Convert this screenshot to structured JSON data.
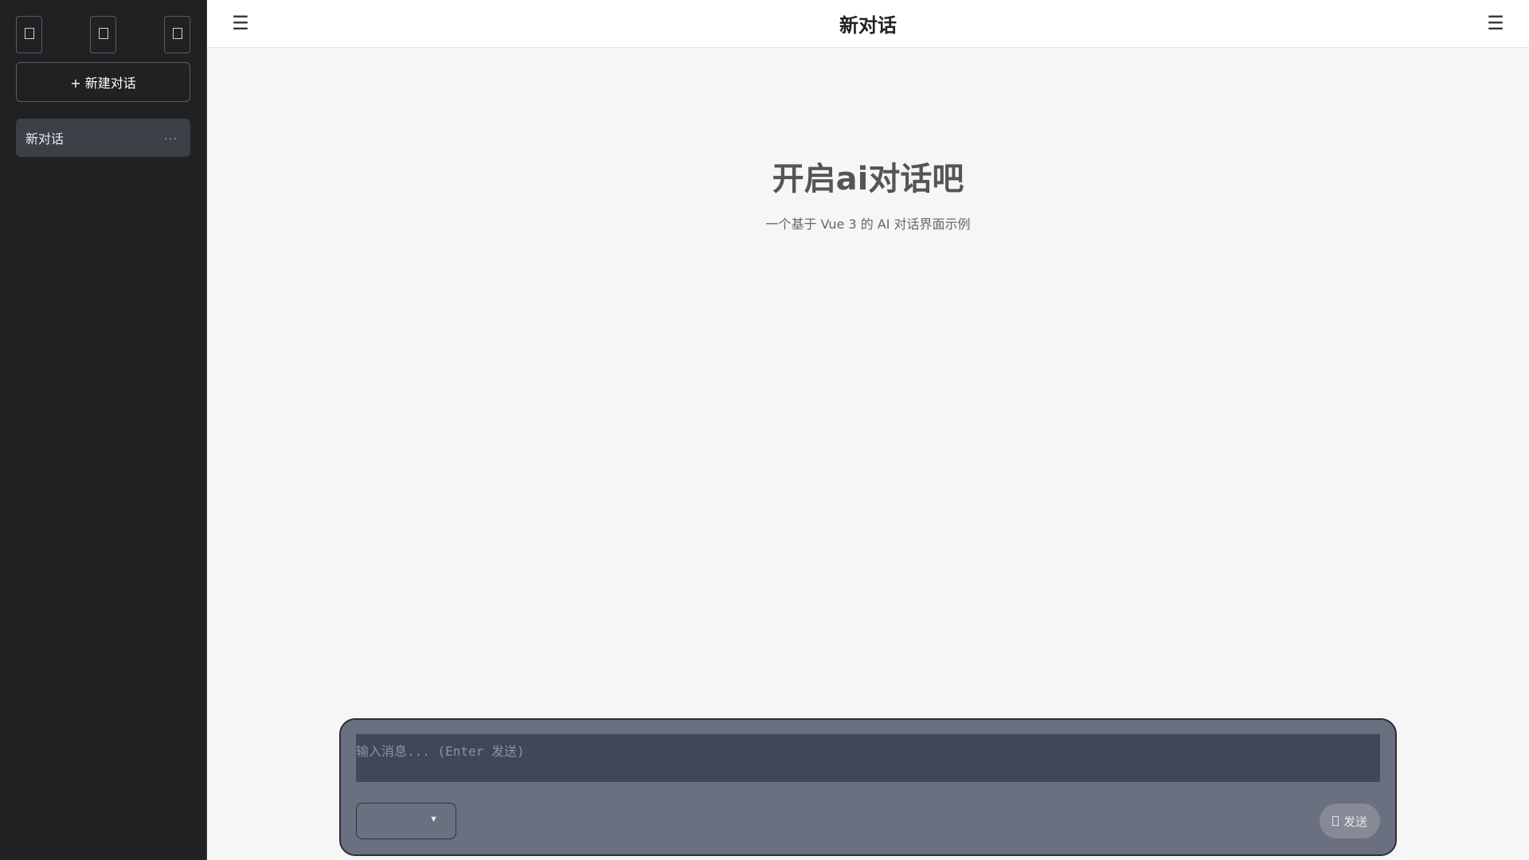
{
  "sidebar": {
    "new_chat_label": "+ 新建对话",
    "conversations": [
      {
        "title": "新对话",
        "more": "···"
      }
    ]
  },
  "header": {
    "title": "新对话",
    "left_menu_glyph": "☰",
    "right_menu_glyph": "☰"
  },
  "welcome": {
    "title": "开启ai对话吧",
    "subtitle": "一个基于 Vue 3 的 AI 对话界面示例"
  },
  "composer": {
    "placeholder": "输入消息... (Enter 发送)",
    "model_value": "",
    "caret": "▼",
    "send_label": "发送"
  },
  "colors": {
    "sidebar_bg": "#202123",
    "conversation_active_bg": "#3d3f47",
    "main_bg": "#f6f6f6",
    "composer_bg": "#6b7080",
    "input_bg": "#404858"
  }
}
